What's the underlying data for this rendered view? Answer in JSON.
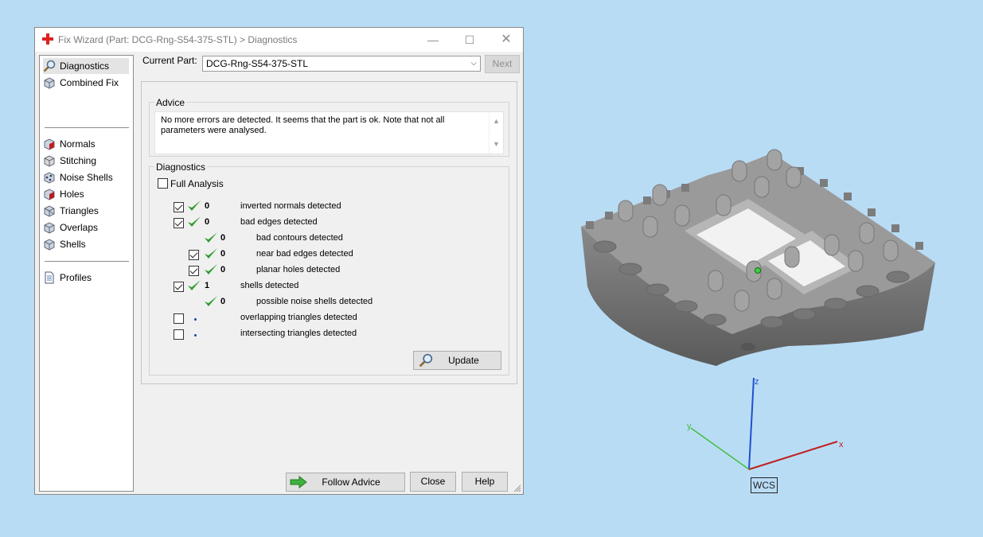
{
  "window": {
    "title": "Fix Wizard (Part: DCG-Rng-S54-375-STL) > Diagnostics",
    "min_glyph": "—",
    "max_glyph": "☐",
    "close_glyph": "✕"
  },
  "sidebar": {
    "items": [
      {
        "label": "Diagnostics",
        "icon": "magnifier-icon",
        "selected": true
      },
      {
        "label": "Combined Fix",
        "icon": "cube-icon"
      },
      {
        "label": "Normals",
        "icon": "normals-cube-icon"
      },
      {
        "label": "Stitching",
        "icon": "stitching-cube-icon"
      },
      {
        "label": "Noise Shells",
        "icon": "noise-shells-icon"
      },
      {
        "label": "Holes",
        "icon": "holes-cube-icon"
      },
      {
        "label": "Triangles",
        "icon": "triangles-cube-icon"
      },
      {
        "label": "Overlaps",
        "icon": "overlaps-cube-icon"
      },
      {
        "label": "Shells",
        "icon": "shells-cube-icon"
      },
      {
        "label": "Profiles",
        "icon": "document-icon"
      }
    ]
  },
  "current_part": {
    "label": "Current Part:",
    "value": "DCG-Rng-S54-375-STL",
    "next_label": "Next"
  },
  "advice": {
    "label": "Advice",
    "text": "No more errors are detected. It seems that the part is ok. Note that not all parameters were analysed."
  },
  "diagnostics": {
    "label": "Diagnostics",
    "full_analysis_label": "Full Analysis",
    "rows": [
      {
        "checked": true,
        "count": "0",
        "text": "inverted normals detected"
      },
      {
        "checked": true,
        "count": "0",
        "text": "bad edges detected"
      },
      {
        "count": "0",
        "text": "bad contours detected"
      },
      {
        "checked": true,
        "count": "0",
        "text": "near bad edges detected"
      },
      {
        "checked": true,
        "count": "0",
        "text": "planar holes detected"
      },
      {
        "checked": true,
        "count": "1",
        "text": "shells detected"
      },
      {
        "count": "0",
        "text": "possible noise shells detected"
      },
      {
        "checked": false,
        "text": "overlapping triangles detected"
      },
      {
        "checked": false,
        "text": "intersecting triangles detected"
      }
    ],
    "update_label": "Update"
  },
  "footer": {
    "follow_advice_label": "Follow Advice",
    "close_label": "Close",
    "help_label": "Help"
  },
  "viewport": {
    "wcs_label": "WCS",
    "axis_x": "x",
    "axis_y": "y",
    "axis_z": "z"
  },
  "colors": {
    "accent_check": "#2e9c2e",
    "background": "#b9dcf5",
    "axis_x": "#c02020",
    "axis_y": "#40c040",
    "axis_z": "#2050d0"
  }
}
